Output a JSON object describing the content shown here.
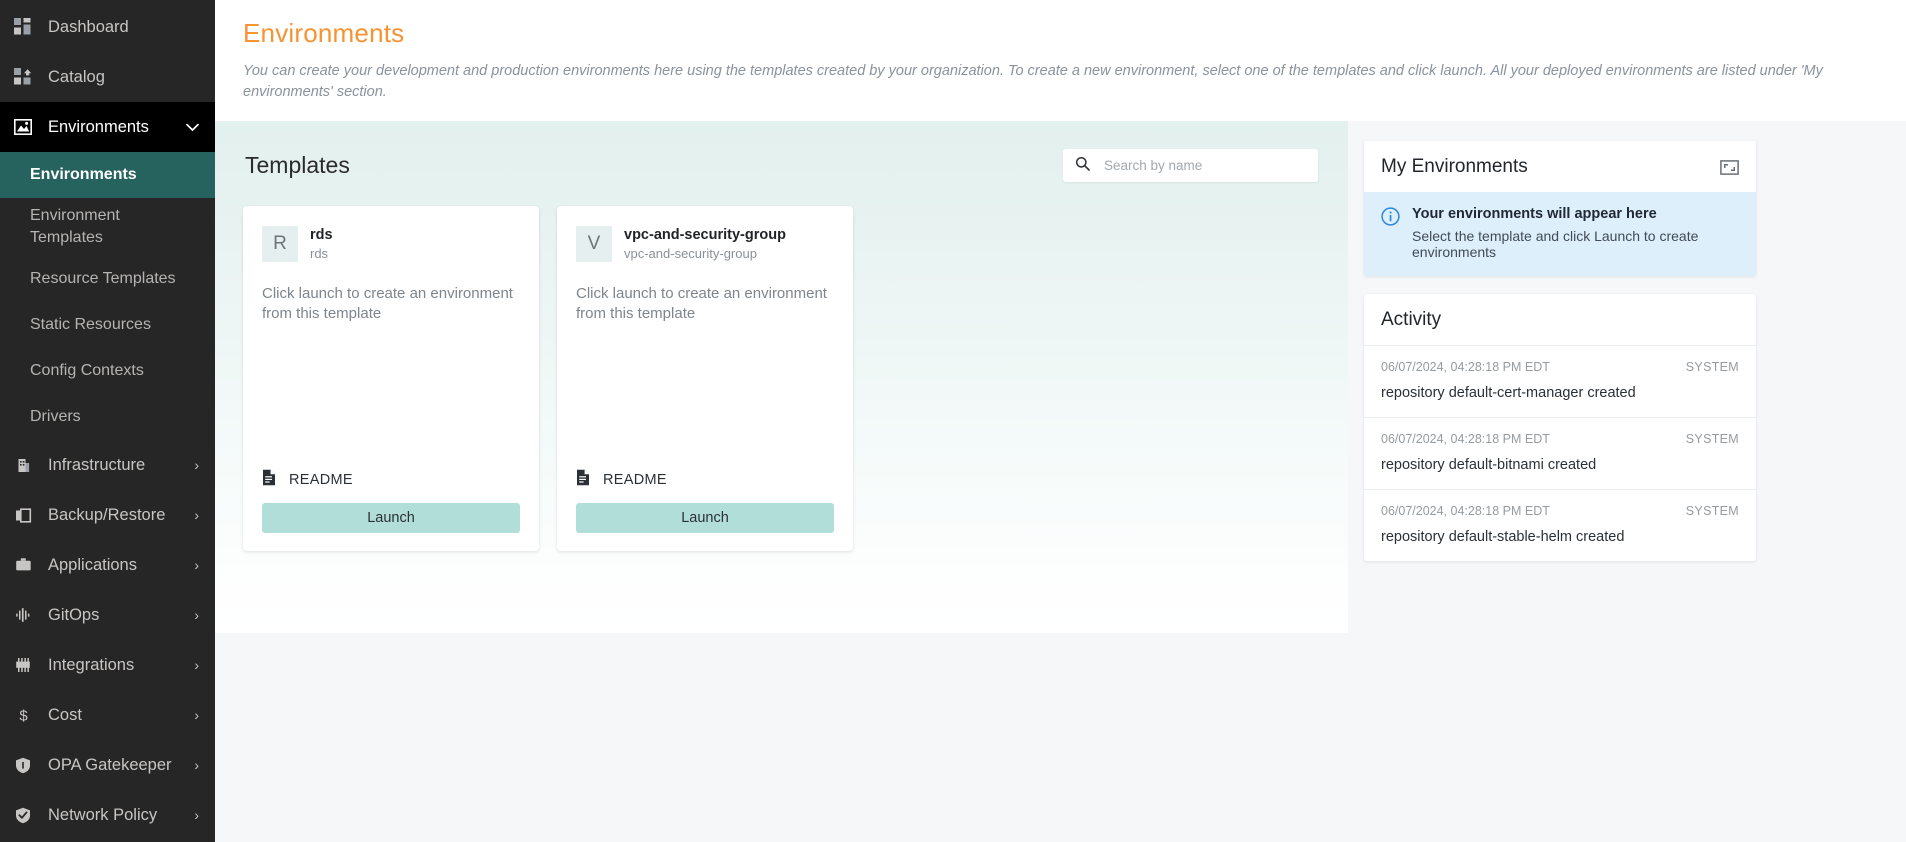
{
  "sidebar": {
    "items": [
      {
        "label": "Dashboard",
        "icon": "dashboard-grid-icon",
        "expandable": false
      },
      {
        "label": "Catalog",
        "icon": "catalog-icon",
        "expandable": false
      },
      {
        "label": "Environments",
        "icon": "environments-image-icon",
        "expandable": true,
        "expanded": true,
        "chevron": "⌄"
      }
    ],
    "environments_subitems": [
      {
        "label": "Environments",
        "active": true
      },
      {
        "label": "Environment Templates",
        "active": false
      },
      {
        "label": "Resource Templates",
        "active": false
      },
      {
        "label": "Static Resources",
        "active": false
      },
      {
        "label": "Config Contexts",
        "active": false
      },
      {
        "label": "Drivers",
        "active": false
      }
    ],
    "bottom_items": [
      {
        "label": "Infrastructure",
        "icon": "building-icon",
        "chevron": "›"
      },
      {
        "label": "Backup/Restore",
        "icon": "copy-icon",
        "chevron": "›"
      },
      {
        "label": "Applications",
        "icon": "briefcase-icon",
        "chevron": "›"
      },
      {
        "label": "GitOps",
        "icon": "gitops-waveform-icon",
        "chevron": "›"
      },
      {
        "label": "Integrations",
        "icon": "integrations-pins-icon",
        "chevron": "›"
      },
      {
        "label": "Cost",
        "icon": "dollar-icon",
        "chevron": "›"
      },
      {
        "label": "OPA Gatekeeper",
        "icon": "shield-icon",
        "chevron": "›"
      },
      {
        "label": "Network Policy",
        "icon": "shield-check-icon",
        "chevron": "›"
      }
    ]
  },
  "header": {
    "title": "Environments",
    "description": "You can create your development and production environments here using the templates created by your organization. To create a new environment, select one of the templates and click launch. All your deployed environments are listed under 'My environments' section."
  },
  "templates": {
    "title": "Templates",
    "search": {
      "placeholder": "Search by name",
      "value": "",
      "icon": "search-icon"
    },
    "cards": [
      {
        "avatar_letter": "R",
        "name": "rds",
        "subtitle": "rds",
        "description": "Click launch to create an environment from this template",
        "readme_label": "README",
        "readme_icon": "document-icon",
        "launch_label": "Launch"
      },
      {
        "avatar_letter": "V",
        "name": "vpc-and-security-group",
        "subtitle": "vpc-and-security-group",
        "description": "Click launch to create an environment from this template",
        "readme_label": "README",
        "readme_icon": "document-icon",
        "launch_label": "Launch"
      }
    ]
  },
  "my_environments": {
    "title": "My Environments",
    "expand_icon": "expand-fullscreen-icon",
    "info": {
      "icon": "info-circle-icon",
      "title": "Your environments will appear here",
      "subtitle": "Select the template and click Launch to create environments"
    }
  },
  "activity": {
    "title": "Activity",
    "rows": [
      {
        "time": "06/07/2024, 04:28:18 PM EDT",
        "actor": "SYSTEM",
        "text": "repository default-cert-manager created"
      },
      {
        "time": "06/07/2024, 04:28:18 PM EDT",
        "actor": "SYSTEM",
        "text": "repository default-bitnami created"
      },
      {
        "time": "06/07/2024, 04:28:18 PM EDT",
        "actor": "SYSTEM",
        "text": "repository default-stable-helm created"
      }
    ]
  },
  "colors": {
    "accent_orange": "#f79331",
    "sidebar_bg": "#262626",
    "sidebar_active_teal": "#27635e",
    "launch_button": "#b2ded9",
    "info_strip": "#ddeffb",
    "panel_gradient_top": "#e2f0ee"
  }
}
